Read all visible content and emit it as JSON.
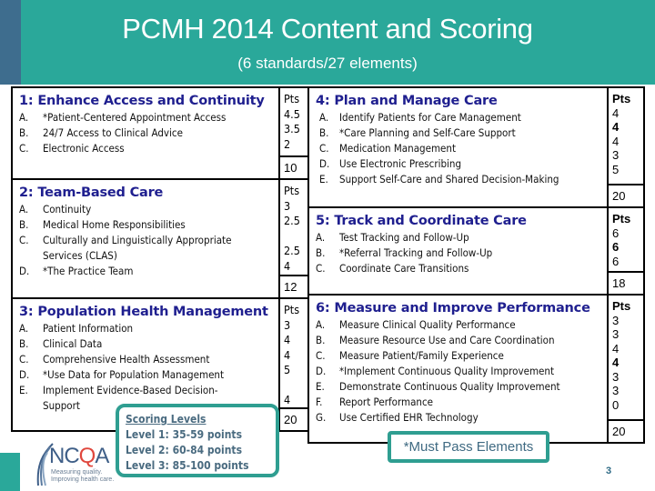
{
  "header": {
    "title": "PCMH 2014 Content and Scoring",
    "subtitle": "(6 standards/27 elements)",
    "colors": {
      "band": "#2aa89a",
      "strip": "#3e6d8e",
      "standard_title": "#1f1f8f"
    }
  },
  "pts_label": "Pts",
  "standards": [
    {
      "title": "1: Enhance Access and Continuity",
      "items": [
        {
          "letter": "A.",
          "text": "*Patient-Centered Appointment Access",
          "pts": "4.5",
          "must_pass": true
        },
        {
          "letter": "B.",
          "text": " 24/7 Access to Clinical Advice",
          "pts": "3.5",
          "must_pass": false
        },
        {
          "letter": "C.",
          "text": "Electronic Access",
          "pts": "2",
          "must_pass": false
        }
      ],
      "total": "10"
    },
    {
      "title": "2: Team-Based Care",
      "items": [
        {
          "letter": "A.",
          "text": "Continuity",
          "pts": "3",
          "must_pass": false
        },
        {
          "letter": "B.",
          "text": "Medical Home Responsibilities",
          "pts": "2.5",
          "must_pass": false
        },
        {
          "letter": "C.",
          "text": "Culturally and Linguistically Appropriate Services (CLAS)",
          "pts": "2.5",
          "must_pass": false
        },
        {
          "letter": "D.",
          "text": "*The Practice Team",
          "pts": "4",
          "must_pass": true
        }
      ],
      "total": "12"
    },
    {
      "title": "3: Population Health Management",
      "items": [
        {
          "letter": "A.",
          "text": "Patient Information",
          "pts": "3",
          "must_pass": false
        },
        {
          "letter": "B.",
          "text": "Clinical Data",
          "pts": "4",
          "must_pass": false
        },
        {
          "letter": "C.",
          "text": "Comprehensive Health Assessment",
          "pts": "4",
          "must_pass": false
        },
        {
          "letter": "D.",
          "text": "*Use Data for Population Management",
          "pts": "5",
          "must_pass": true
        },
        {
          "letter": "E.",
          "text": "Implement Evidence-Based Decision-Support",
          "pts": "4",
          "must_pass": false
        }
      ],
      "total": "20"
    },
    {
      "title": "4: Plan and Manage Care",
      "items": [
        {
          "letter": "A.",
          "text": "Identify Patients for Care Management",
          "pts": "4",
          "must_pass": false
        },
        {
          "letter": "B.",
          "text": "*Care Planning and Self-Care Support",
          "pts": "4",
          "must_pass": true
        },
        {
          "letter": "C.",
          "text": "Medication Management",
          "pts": "4",
          "must_pass": false
        },
        {
          "letter": "D.",
          "text": "Use Electronic Prescribing",
          "pts": "3",
          "must_pass": false
        },
        {
          "letter": "E.",
          "text": "Support Self-Care and Shared Decision-Making",
          "pts": "5",
          "must_pass": false
        }
      ],
      "total": "20"
    },
    {
      "title": "5: Track and Coordinate Care",
      "items": [
        {
          "letter": "A.",
          "text": "Test Tracking and Follow-Up",
          "pts": "6",
          "must_pass": false
        },
        {
          "letter": "B.",
          "text": "*Referral Tracking and Follow-Up",
          "pts": "6",
          "must_pass": true
        },
        {
          "letter": "C.",
          "text": "Coordinate Care Transitions",
          "pts": "6",
          "must_pass": false
        }
      ],
      "total": "18"
    },
    {
      "title": "6: Measure and Improve Performance",
      "items": [
        {
          "letter": "A.",
          "text": "Measure Clinical Quality Performance",
          "pts": "3",
          "must_pass": false
        },
        {
          "letter": "B.",
          "text": "Measure Resource Use and Care Coordination",
          "pts": "3",
          "must_pass": false
        },
        {
          "letter": "C.",
          "text": "Measure Patient/Family Experience",
          "pts": "4",
          "must_pass": false
        },
        {
          "letter": "D.",
          "text": "*Implement Continuous Quality Improvement",
          "pts": "4",
          "must_pass": true
        },
        {
          "letter": "E.",
          "text": "Demonstrate Continuous Quality Improvement",
          "pts": "3",
          "must_pass": false
        },
        {
          "letter": "F.",
          "text": "Report Performance",
          "pts": "3",
          "must_pass": false
        },
        {
          "letter": "G.",
          "text": "Use Certified EHR Technology",
          "pts": "0",
          "must_pass": false
        }
      ],
      "total": "20"
    }
  ],
  "scoring_levels": {
    "heading": "Scoring Levels",
    "levels": [
      "Level 1:  35-59 points",
      "Level 2:  60-84 points",
      "Level 3:  85-100 points"
    ]
  },
  "must_pass_note": "*Must Pass Elements",
  "logo": {
    "name_prefix": "NC",
    "name_q": "Q",
    "name_suffix": "A",
    "tagline_1": "Measuring quality.",
    "tagline_2": "Improving health care."
  },
  "page_number": "3"
}
